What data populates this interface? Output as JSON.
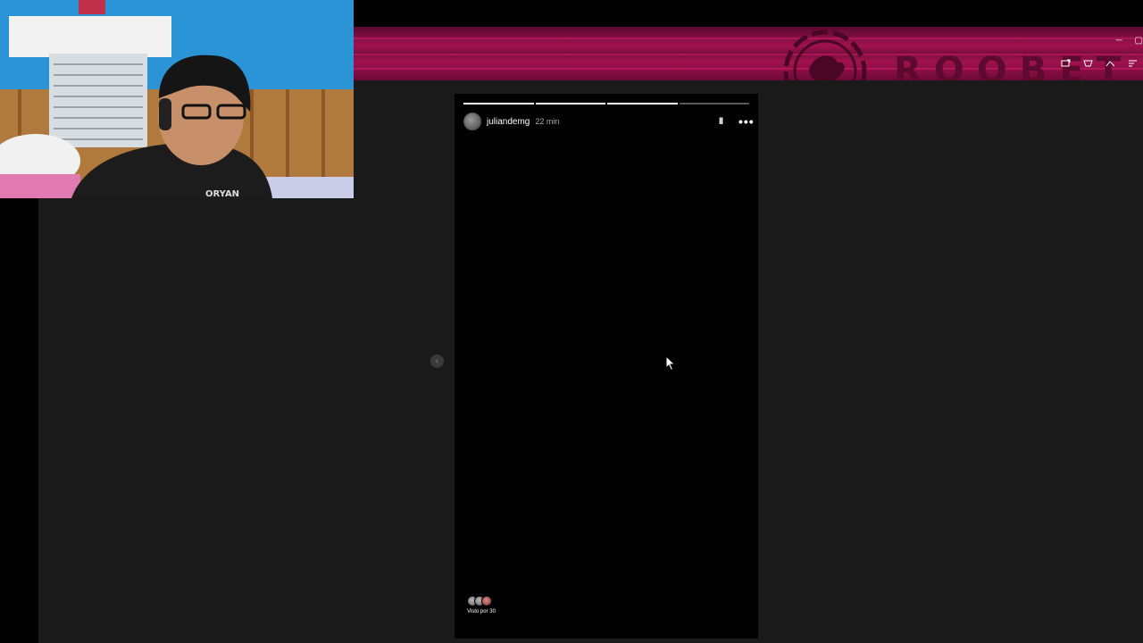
{
  "banner": {
    "brand": "ROOBET",
    "logo_icon": "roobet-kangaroo-logo-icon",
    "window_controls": [
      "─",
      "▢"
    ],
    "tray_icons": [
      "tray-icon-1",
      "tray-icon-2",
      "tray-icon-3",
      "tray-icon-4"
    ]
  },
  "webcam": {
    "description_icon": "webcam-feed"
  },
  "story": {
    "username": "juliandemg",
    "time_ago": "22 min",
    "progress": [
      1.0,
      1.0,
      1.0,
      0.0
    ],
    "pause_label": "II",
    "more_label": "•••",
    "viewers_label": "Visto por 30"
  },
  "nav": {
    "prev_label": "‹"
  },
  "colors": {
    "banner_primary": "#a0124f",
    "banner_dark": "#5a0930",
    "viewer_background": "#1a1a1a",
    "story_background": "#000000"
  }
}
